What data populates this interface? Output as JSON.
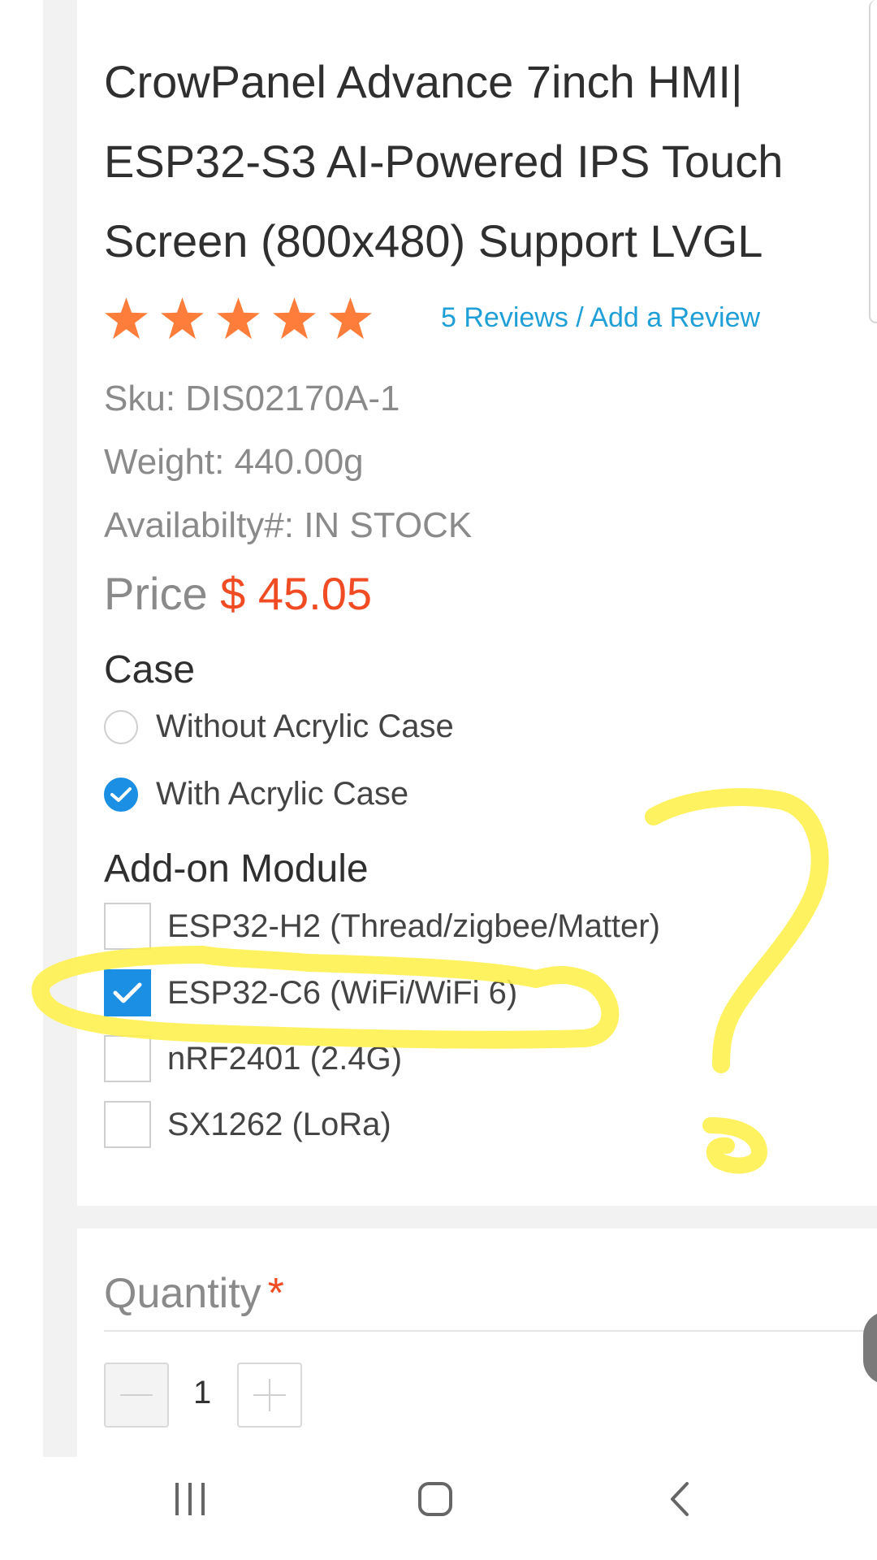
{
  "product": {
    "title": "CrowPanel Advance 7inch HMI| ESP32-S3 AI-Powered IPS Touch Screen (800x480) Support LVGL",
    "rating_stars": 5,
    "reviews_link": "5 Reviews / Add a Review",
    "sku": "Sku: DIS02170A-1",
    "weight": "Weight: 440.00g",
    "availability": "Availabilty#: IN STOCK",
    "price_label": "Price",
    "price_value": "$ 45.05"
  },
  "case_option": {
    "title": "Case",
    "options": [
      {
        "label": "Without Acrylic Case",
        "selected": false
      },
      {
        "label": "With Acrylic Case",
        "selected": true
      }
    ]
  },
  "addon": {
    "title": "Add-on Module",
    "options": [
      {
        "label": "ESP32-H2 (Thread/zigbee/Matter)",
        "checked": false
      },
      {
        "label": "ESP32-C6 (WiFi/WiFi 6)",
        "checked": true
      },
      {
        "label": "nRF2401 (2.4G)",
        "checked": false
      },
      {
        "label": "SX1262 (LoRa)",
        "checked": false
      }
    ]
  },
  "quantity": {
    "label": "Quantity",
    "required_mark": "*",
    "value": "1"
  },
  "icons": {
    "star": "star-icon",
    "radio_check": "check-icon",
    "minus": "minus-icon",
    "plus": "plus-icon",
    "nav_recents": "recents-icon",
    "nav_home": "home-icon",
    "nav_back": "back-icon"
  },
  "colors": {
    "accent": "#1a8fe3",
    "price": "#f04b23",
    "star": "#ff7d3b",
    "link": "#1f9fd8",
    "annotation": "#fff04a"
  }
}
